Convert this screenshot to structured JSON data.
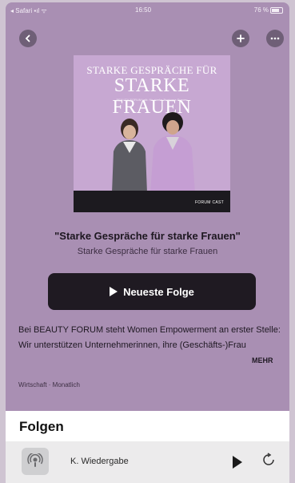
{
  "status_bar": {
    "carrier": "◂ Safari ▪ıl  ᯤ",
    "time": "16:50",
    "battery": "76 %"
  },
  "nav": {
    "back_icon": "chevron-left-icon",
    "add_icon": "plus-icon",
    "more_icon": "ellipsis-icon"
  },
  "cover": {
    "title_line1": "STARKE GESPRÄCHE FÜR",
    "title_line2": "STARKE FRAUEN",
    "subtitle": "BEAUTY FORUM talk: für starke Business Frauen",
    "logo": "FORUM CAST"
  },
  "podcast": {
    "title": "\"Starke Gespräche für starke Frauen\"",
    "author": "Starke Gespräche für starke Frauen",
    "play_label": "Neueste Folge",
    "description": "Bei BEAUTY FORUM steht Women Empowerment an erster Stelle: Wir unterstützen Unternehmerinnen, ihre (Geschäfts-)Frau",
    "more_label": "MEHR",
    "category": "Wirtschaft · Monatlich"
  },
  "episodes": {
    "heading": "Folgen",
    "row_title": "K. Wiedergabe",
    "row_icon": "podcast-icon",
    "play_icon": "play-icon",
    "refresh_icon": "refresh-icon"
  },
  "colors": {
    "background": "#a98fb3",
    "button_dark": "#1f1a22",
    "cover": "#c7a8d2"
  }
}
